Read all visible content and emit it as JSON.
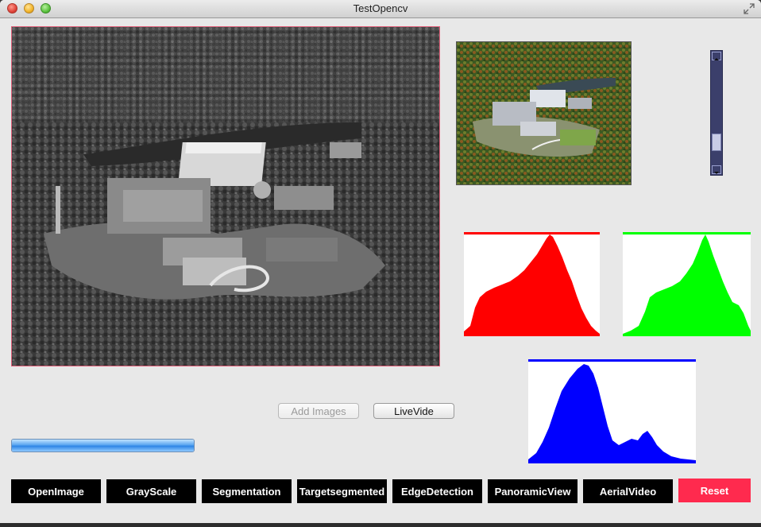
{
  "window": {
    "title": "TestOpencv"
  },
  "icons": {
    "close": "close-dot-icon",
    "minimize": "minimize-dot-icon",
    "maximize": "maximize-dot-icon",
    "fullscreen": "fullscreen-arrows-icon"
  },
  "images": {
    "main": "grayscale-aerial-photo",
    "thumbnail": "color-aerial-photo"
  },
  "histograms": {
    "red_color": "#ff0000",
    "green_color": "#00ff00",
    "blue_color": "#0000ff"
  },
  "controls": {
    "add_images_label": "Add Images",
    "add_images_enabled": false,
    "live_video_label": "LiveVide",
    "progress": 1.0
  },
  "toolbar": {
    "buttons": [
      {
        "label": "OpenImage"
      },
      {
        "label": "GrayScale"
      },
      {
        "label": "Segmentation"
      },
      {
        "label": "Targetsegmented"
      },
      {
        "label": "EdgeDetection"
      },
      {
        "label": "PanoramicView"
      },
      {
        "label": "AerialVideo"
      },
      {
        "label": "Reset"
      }
    ],
    "reset_color": "#ff2a4e"
  }
}
